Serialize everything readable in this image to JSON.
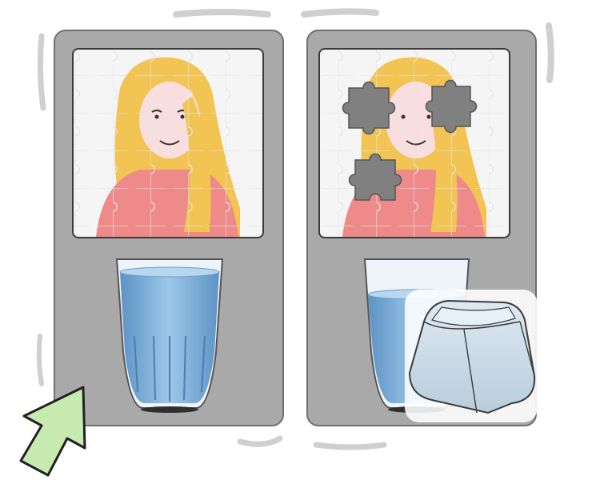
{
  "scene": {
    "panels": [
      {
        "id": "left",
        "puzzle_state": "complete",
        "glass_state": "full"
      },
      {
        "id": "right",
        "puzzle_state": "missing-pieces",
        "missing_piece_count": 3,
        "glass_state": "partial"
      }
    ],
    "icons": [
      "puzzle-icon",
      "water-glass-icon",
      "keycap-icon",
      "arrow-icon"
    ],
    "colors": {
      "panel": "#a9a9a9",
      "panel_border": "#6f6f6f",
      "hair": "#f1c453",
      "dress": "#ef8a8a",
      "skin": "#f8dede",
      "water": "#86b6de",
      "missing_piece": "#808080",
      "keycap": "#cfe0ec",
      "arrow": "#c7eab0"
    }
  }
}
